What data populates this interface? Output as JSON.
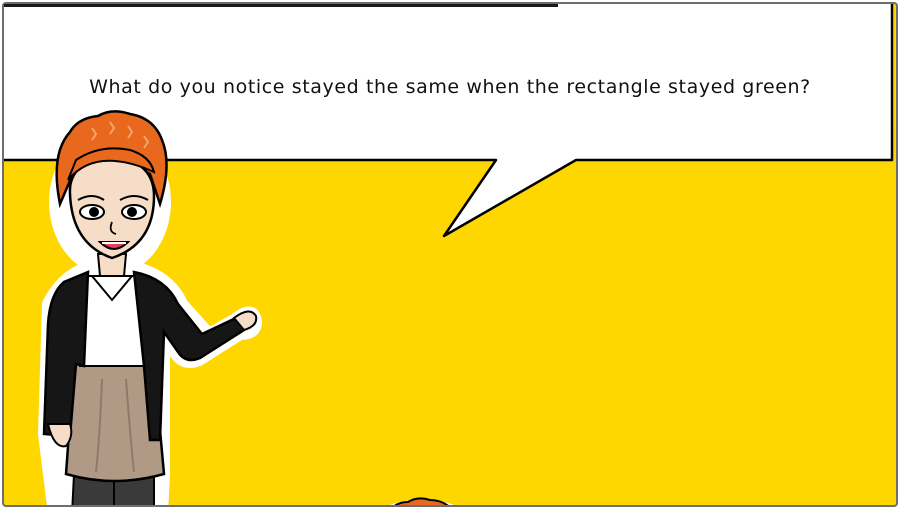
{
  "scene": {
    "background_color": "#ffd700",
    "speech_bubble": {
      "text": "What do you notice stayed the same when the rectangle stayed green?"
    }
  },
  "colors": {
    "hair": "#e8681e",
    "jacket": "#161616",
    "shirt": "#ffffff",
    "skirt": "#b09a86",
    "skin": "#f6ddc7",
    "bubble": "#ffffff",
    "outline": "#000000"
  },
  "icons": [
    "teacher-character",
    "student-head"
  ]
}
